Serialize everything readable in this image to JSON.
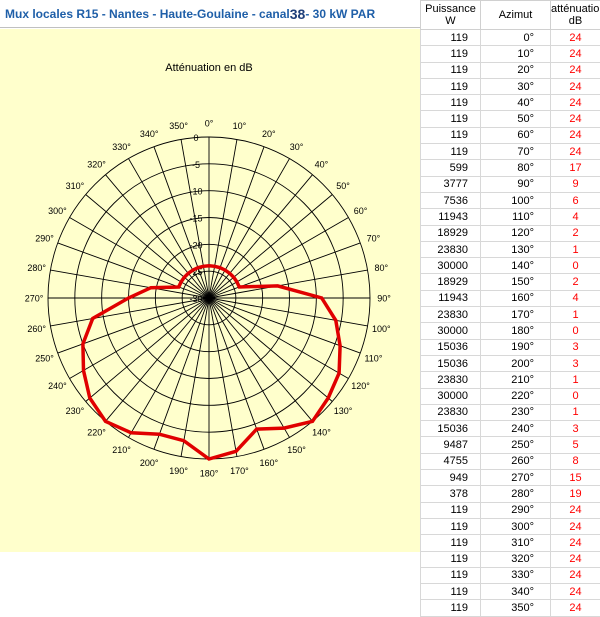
{
  "header": {
    "title_prefix": "Mux locales R15 -  Nantes - Haute-Goulaine - canal ",
    "channel": "38",
    "title_suffix": " - 30 kW PAR"
  },
  "table": {
    "headers": {
      "power": "Puissance W",
      "azimuth": "Azimut",
      "attenuation": "atténuation dB"
    },
    "rows": [
      [
        "119",
        "0°",
        "24"
      ],
      [
        "119",
        "10°",
        "24"
      ],
      [
        "119",
        "20°",
        "24"
      ],
      [
        "119",
        "30°",
        "24"
      ],
      [
        "119",
        "40°",
        "24"
      ],
      [
        "119",
        "50°",
        "24"
      ],
      [
        "119",
        "60°",
        "24"
      ],
      [
        "119",
        "70°",
        "24"
      ],
      [
        "599",
        "80°",
        "17"
      ],
      [
        "3777",
        "90°",
        "9"
      ],
      [
        "7536",
        "100°",
        "6"
      ],
      [
        "11943",
        "110°",
        "4"
      ],
      [
        "18929",
        "120°",
        "2"
      ],
      [
        "23830",
        "130°",
        "1"
      ],
      [
        "30000",
        "140°",
        "0"
      ],
      [
        "18929",
        "150°",
        "2"
      ],
      [
        "11943",
        "160°",
        "4"
      ],
      [
        "23830",
        "170°",
        "1"
      ],
      [
        "30000",
        "180°",
        "0"
      ],
      [
        "15036",
        "190°",
        "3"
      ],
      [
        "15036",
        "200°",
        "3"
      ],
      [
        "23830",
        "210°",
        "1"
      ],
      [
        "30000",
        "220°",
        "0"
      ],
      [
        "23830",
        "230°",
        "1"
      ],
      [
        "15036",
        "240°",
        "3"
      ],
      [
        "9487",
        "250°",
        "5"
      ],
      [
        "4755",
        "260°",
        "8"
      ],
      [
        "949",
        "270°",
        "15"
      ],
      [
        "378",
        "280°",
        "19"
      ],
      [
        "119",
        "290°",
        "24"
      ],
      [
        "119",
        "300°",
        "24"
      ],
      [
        "119",
        "310°",
        "24"
      ],
      [
        "119",
        "320°",
        "24"
      ],
      [
        "119",
        "330°",
        "24"
      ],
      [
        "119",
        "340°",
        "24"
      ],
      [
        "119",
        "350°",
        "24"
      ]
    ]
  },
  "chart_data": {
    "type": "polar-line",
    "title": "Atténuation en dB",
    "angle_labels": [
      "0°",
      "10°",
      "20°",
      "30°",
      "40°",
      "50°",
      "60°",
      "70°",
      "80°",
      "90°",
      "100°",
      "110°",
      "120°",
      "130°",
      "140°",
      "150°",
      "160°",
      "170°",
      "180°",
      "190°",
      "200°",
      "210°",
      "220°",
      "230°",
      "240°",
      "250°",
      "260°",
      "270°",
      "280°",
      "290°",
      "300°",
      "310°",
      "320°",
      "330°",
      "340°",
      "350°"
    ],
    "radial_ticks": [
      0,
      -5,
      -10,
      -15,
      -20,
      -25,
      -30
    ],
    "radial_tick_labels": [
      "0",
      "-5",
      "-10",
      "-15",
      "-20",
      "-25",
      "-30"
    ],
    "radial_range": [
      -30,
      0
    ],
    "azimuth": [
      0,
      10,
      20,
      30,
      40,
      50,
      60,
      70,
      80,
      90,
      100,
      110,
      120,
      130,
      140,
      150,
      160,
      170,
      180,
      190,
      200,
      210,
      220,
      230,
      240,
      250,
      260,
      270,
      280,
      290,
      300,
      310,
      320,
      330,
      340,
      350
    ],
    "attenuation_db": [
      24,
      24,
      24,
      24,
      24,
      24,
      24,
      24,
      17,
      9,
      6,
      4,
      2,
      1,
      0,
      2,
      4,
      1,
      0,
      3,
      3,
      1,
      0,
      1,
      3,
      5,
      8,
      15,
      19,
      24,
      24,
      24,
      24,
      24,
      24,
      24
    ],
    "series_color": "#e00000",
    "background_color": "#ffffcc"
  }
}
